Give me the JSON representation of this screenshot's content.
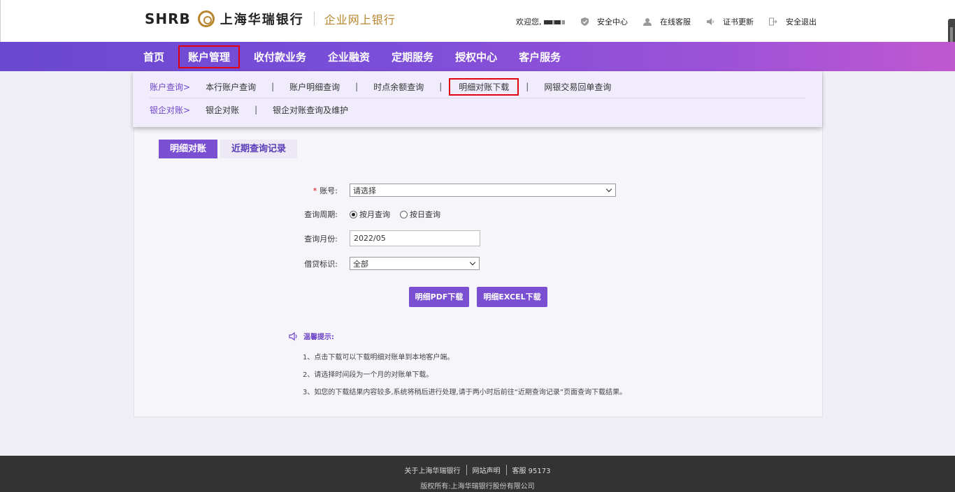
{
  "header": {
    "logo_latin": "SHRB",
    "logo_cn": "上海华瑞银行",
    "portal": "企业网上银行",
    "welcome": "欢迎您,",
    "links": [
      {
        "label": "安全中心",
        "icon": "shield-icon"
      },
      {
        "label": "在线客服",
        "icon": "user-service-icon"
      },
      {
        "label": "证书更新",
        "icon": "certificate-icon"
      },
      {
        "label": "安全退出",
        "icon": "logout-icon"
      }
    ]
  },
  "nav": {
    "items": [
      "首页",
      "账户管理",
      "收付款业务",
      "企业融资",
      "定期服务",
      "授权中心",
      "客户服务"
    ],
    "active": "账户管理"
  },
  "submenu": {
    "row1": {
      "category": "账户查询>",
      "items": [
        "本行账户查询",
        "账户明细查询",
        "时点余额查询",
        "明细对账下载",
        "网银交易回单查询"
      ],
      "highlighted": "明细对账下载"
    },
    "row2": {
      "category": "银企对账>",
      "items": [
        "银企对账",
        "银企对账查询及维护"
      ]
    },
    "separator": "|"
  },
  "tabs": [
    "明细对账",
    "近期查询记录"
  ],
  "form": {
    "account_label": "账号:",
    "account_placeholder": "请选择",
    "period_label": "查询周期:",
    "period_options": [
      "按月查询",
      "按日查询"
    ],
    "period_selected": "按月查询",
    "month_label": "查询月份:",
    "month_value": "2022/05",
    "flag_label": "借贷标识:",
    "flag_value": "全部",
    "required_mark": "*"
  },
  "buttons": {
    "pdf": "明细PDF下载",
    "excel": "明细EXCEL下载"
  },
  "tips": {
    "title": "温馨提示:",
    "items": [
      "1、点击下载可以下载明细对账单到本地客户端。",
      "2、请选择时间段为一个月的对账单下载。",
      "3、如您的下载结果内容较多,系统将稍后进行处理,请于两小时后前往“近期查询记录”页面查询下载结果。"
    ]
  },
  "footer": {
    "links": [
      "关于上海华瑞银行",
      "网站声明",
      "客服 95173"
    ],
    "copyright": "版权所有:上海华瑞银行股份有限公司"
  },
  "colors": {
    "accent": "#7a4fd1",
    "brand_gold": "#b8862e",
    "highlight_red": "#e0000f"
  }
}
